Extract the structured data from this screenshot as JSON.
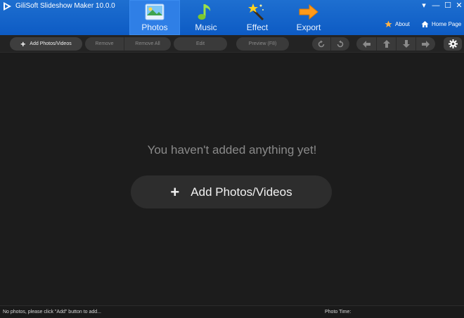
{
  "app": {
    "title": "GiliSoft Slideshow Maker 10.0.0"
  },
  "tabs": [
    {
      "label": "Photos",
      "icon": "photo-icon",
      "active": true
    },
    {
      "label": "Music",
      "icon": "music-note-icon",
      "active": false
    },
    {
      "label": "Effect",
      "icon": "magic-wand-icon",
      "active": false
    },
    {
      "label": "Export",
      "icon": "arrow-right-icon",
      "active": false
    }
  ],
  "header_links": {
    "about": "About",
    "home_page": "Home Page"
  },
  "window_controls": {
    "menu": "▾",
    "minimize": "—",
    "maximize": "☐",
    "close": "✕"
  },
  "toolbar": {
    "add": "Add Photos/Videos",
    "remove": "Remove",
    "remove_all": "Remove All",
    "edit": "Edit",
    "preview": "Preview (F8)"
  },
  "main": {
    "empty_message": "You haven't added anything yet!",
    "add_button": "Add Photos/Videos"
  },
  "status": {
    "left": "No photos, please click \"Add\" button to add...",
    "photo_time_label": "Photo Time:"
  },
  "colors": {
    "header_blue": "#1565c8",
    "active_tab": "#2f7fe6",
    "background": "#1c1c1c",
    "button_dark": "#3a3a3a"
  }
}
